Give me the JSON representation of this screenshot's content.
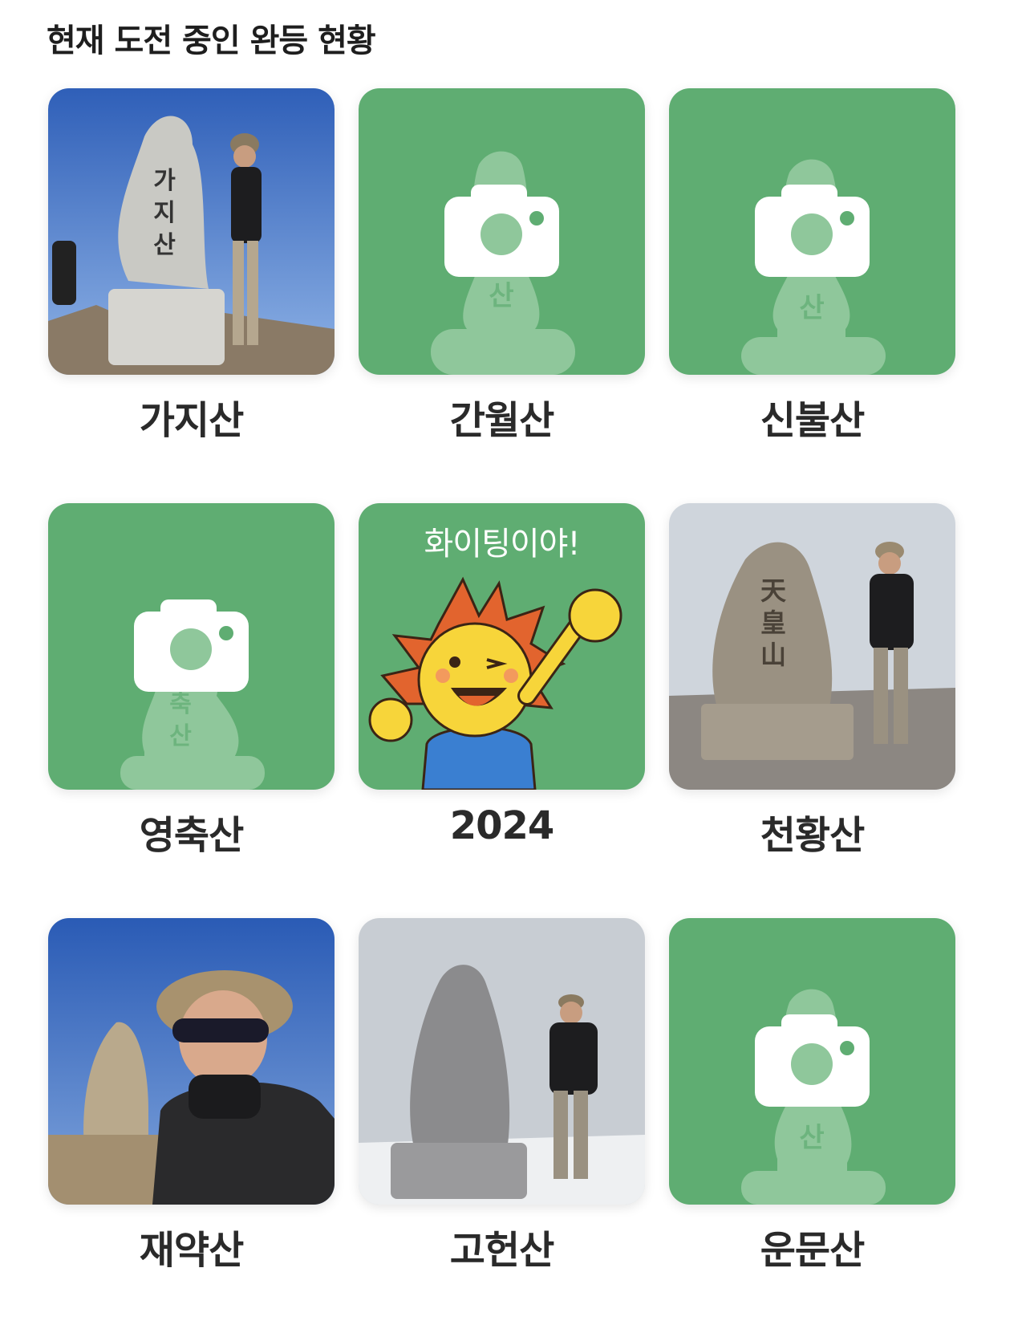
{
  "section_title": "현재 도전 중인 완등 현황",
  "colors": {
    "card_green": "#5fad72",
    "stone_green": "#8fc79b",
    "camera_white": "#ffffff"
  },
  "mountains": [
    {
      "name": "가지산",
      "status": "photo",
      "icon": "summit-photo"
    },
    {
      "name": "간월산",
      "status": "empty",
      "icon": "camera-icon"
    },
    {
      "name": "신불산",
      "status": "empty",
      "icon": "camera-icon"
    },
    {
      "name": "영축산",
      "status": "empty",
      "icon": "camera-icon"
    },
    {
      "name": "2024",
      "status": "cheer",
      "icon": "sun-mascot",
      "banner": "화이팅이야!"
    },
    {
      "name": "천황산",
      "status": "photo",
      "icon": "summit-photo"
    },
    {
      "name": "재약산",
      "status": "photo",
      "icon": "summit-photo"
    },
    {
      "name": "고헌산",
      "status": "photo",
      "icon": "summit-photo"
    },
    {
      "name": "운문산",
      "status": "empty",
      "icon": "camera-icon"
    }
  ]
}
